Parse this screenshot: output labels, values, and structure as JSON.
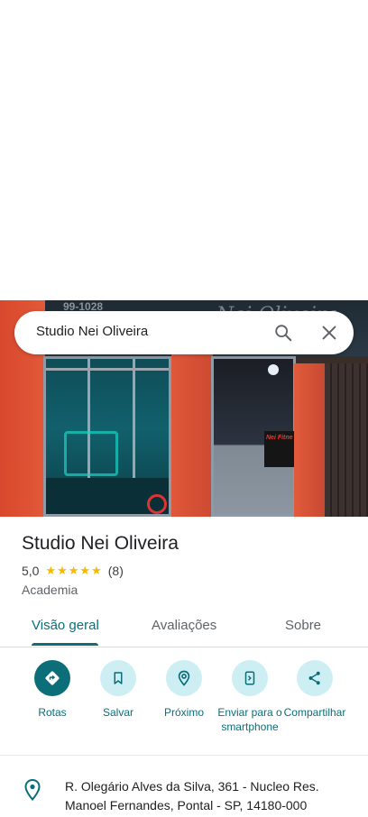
{
  "search": {
    "query": "Studio Nei Oliveira",
    "search_icon": "search-icon",
    "close_icon": "close-icon"
  },
  "photo": {
    "sign_text": "Nei Oliveira",
    "sign_phone": "99-1028",
    "banner_text": "Nei Fitne"
  },
  "place": {
    "title": "Studio Nei Oliveira",
    "rating": "5,0",
    "stars": "★★★★★",
    "review_count": "(8)",
    "category": "Academia"
  },
  "tabs": [
    {
      "label": "Visão geral",
      "active": true
    },
    {
      "label": "Avaliações",
      "active": false
    },
    {
      "label": "Sobre",
      "active": false
    }
  ],
  "actions": [
    {
      "label": "Rotas",
      "icon": "directions-icon"
    },
    {
      "label": "Salvar",
      "icon": "bookmark-icon"
    },
    {
      "label": "Próximo",
      "icon": "nearby-icon"
    },
    {
      "label": "Enviar para o smartphone",
      "icon": "send-to-phone-icon"
    },
    {
      "label": "Compartilhar",
      "icon": "share-icon"
    }
  ],
  "address": {
    "text": "R. Olegário Alves da Silva, 361 - Nucleo Res. Manoel Fernandes, Pontal - SP, 14180-000",
    "icon": "location-pin-icon"
  },
  "colors": {
    "accent": "#0b6e78",
    "action_bg": "#cdeff4",
    "star": "#f6b800"
  }
}
